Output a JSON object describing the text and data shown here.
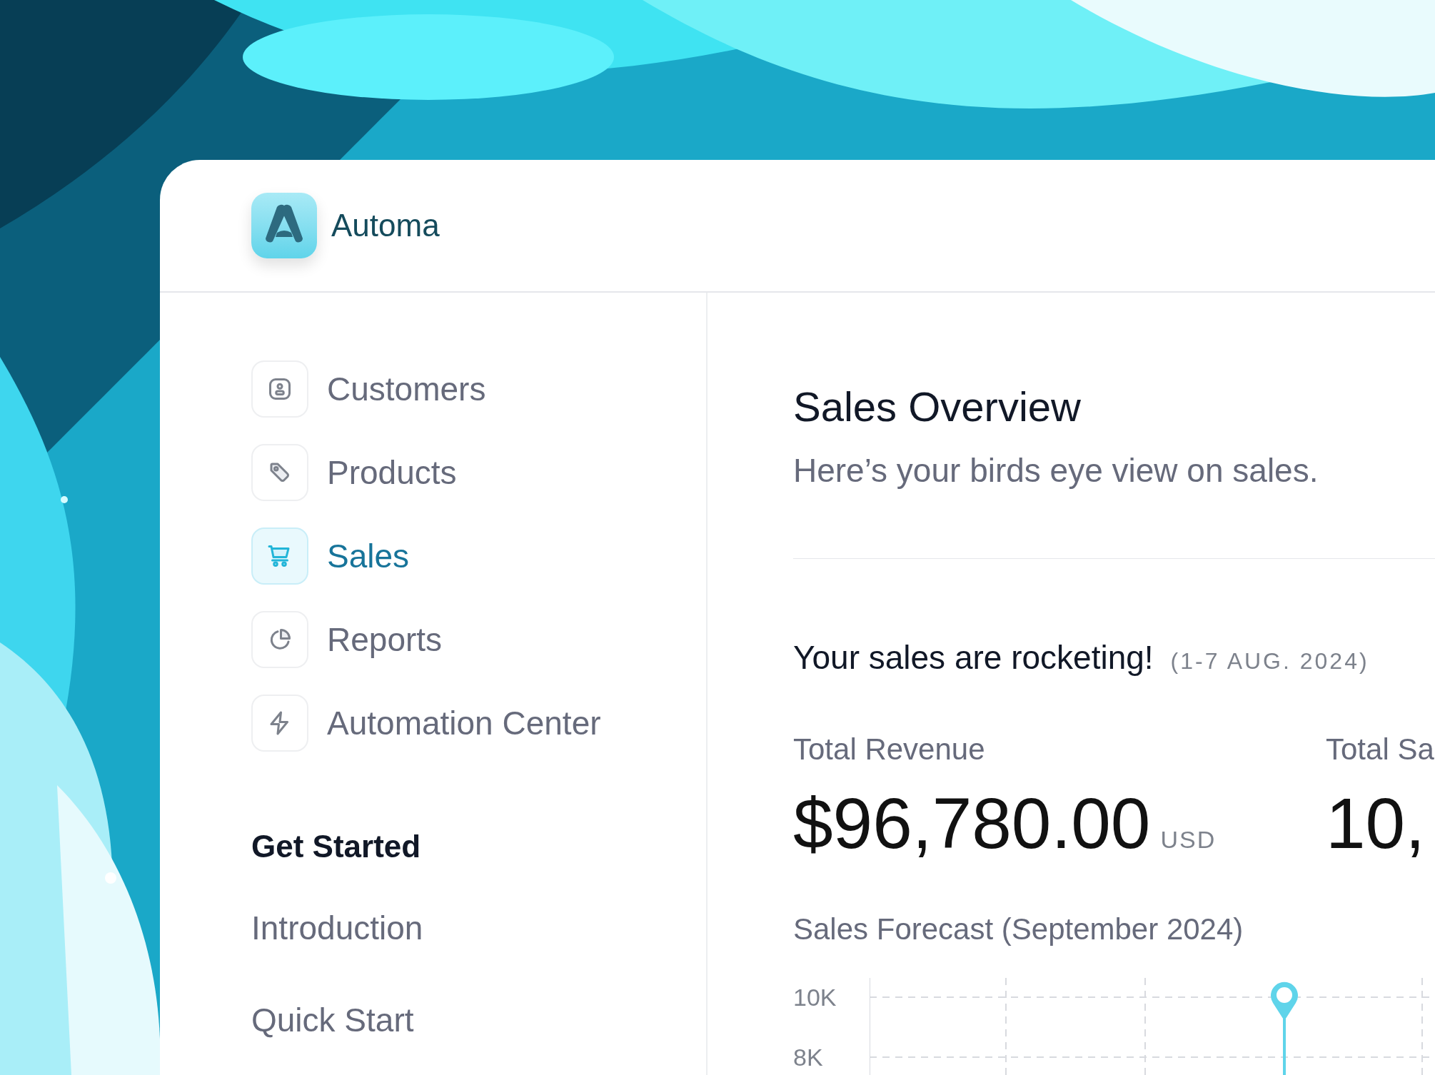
{
  "brand": {
    "name": "Automa"
  },
  "sidebar": {
    "items": [
      {
        "label": "Customers",
        "kind": "user",
        "selected": false
      },
      {
        "label": "Products",
        "kind": "tag",
        "selected": false
      },
      {
        "label": "Sales",
        "kind": "cart",
        "selected": true
      },
      {
        "label": "Reports",
        "kind": "pie",
        "selected": false
      },
      {
        "label": "Automation Center",
        "kind": "bolt",
        "selected": false
      }
    ],
    "section": {
      "title": "Get Started",
      "links": [
        "Introduction",
        "Quick Start"
      ]
    }
  },
  "main": {
    "title": "Sales Overview",
    "subtitle": "Here’s your birds eye view on sales.",
    "highlight": {
      "headline": "Your sales are rocketing!",
      "period": "(1-7 AUG. 2024)"
    },
    "stats": [
      {
        "label": "Total Revenue",
        "value": "$96,780.00",
        "unit": "USD"
      },
      {
        "label": "Total Sa",
        "value": "10,"
      }
    ],
    "forecast": {
      "title": "Sales Forecast (September 2024)",
      "y_labels": [
        "10K",
        "8K"
      ]
    }
  }
}
